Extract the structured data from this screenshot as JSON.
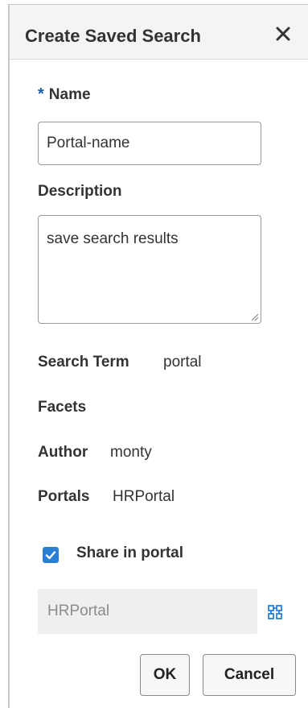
{
  "dialog": {
    "title": "Create Saved Search",
    "close_icon": "close-icon"
  },
  "form": {
    "name": {
      "required_marker": "*",
      "label": "Name",
      "value": "Portal-name"
    },
    "description": {
      "label": "Description",
      "value": "save search results"
    },
    "details": {
      "search_term_label": "Search Term",
      "search_term_value": "portal",
      "facets_label": "Facets",
      "author_label": "Author",
      "author_value": "monty",
      "portals_label": "Portals",
      "portals_value": "HRPortal"
    },
    "share": {
      "checked": true,
      "label": "Share in portal",
      "portal_value": "HRPortal",
      "picker_icon": "portal-picker-icon"
    }
  },
  "buttons": {
    "ok": "OK",
    "cancel": "Cancel"
  },
  "colors": {
    "accent": "#2a7fd4",
    "required": "#1a5ea8",
    "header_bg": "#f4f4f4"
  }
}
